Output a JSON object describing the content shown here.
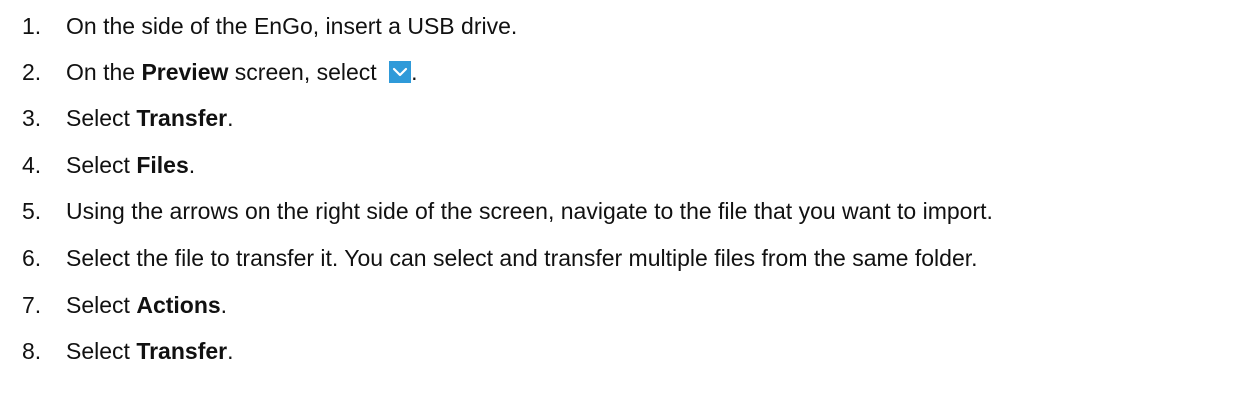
{
  "steps": [
    {
      "num": "1.",
      "text": "On the side of the EnGo, insert a USB drive."
    },
    {
      "num": "2.",
      "pre": "On the ",
      "bold": "Preview",
      "mid": " screen, select ",
      "post": ".",
      "icon": "chevron-down-icon"
    },
    {
      "num": "3.",
      "pre": "Select ",
      "bold": "Transfer",
      "post": "."
    },
    {
      "num": "4.",
      "pre": "Select ",
      "bold": "Files",
      "post": "."
    },
    {
      "num": "5.",
      "text": "Using the arrows on the right side of the screen, navigate to the file that you want to import."
    },
    {
      "num": "6.",
      "text": "Select the file to transfer it. You can select and transfer multiple files from the same folder."
    },
    {
      "num": "7.",
      "pre": "Select ",
      "bold": "Actions",
      "post": "."
    },
    {
      "num": "8.",
      "pre": "Select ",
      "bold": "Transfer",
      "post": "."
    }
  ],
  "colors": {
    "icon_bg": "#2f9ad9",
    "icon_fg": "#ffffff",
    "text": "#111111"
  }
}
